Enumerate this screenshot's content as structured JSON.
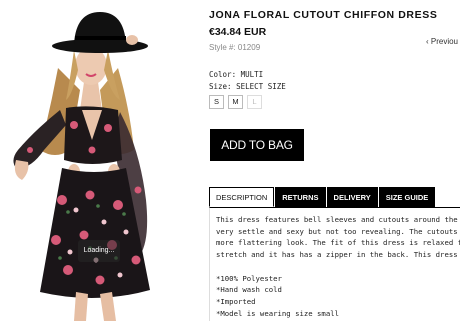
{
  "product": {
    "title": "JONA FLORAL CUTOUT CHIFFON DRESS",
    "price": "€34.84 EUR",
    "style": "Style #: 01209",
    "previous": "‹ Previou",
    "color": "Color: MULTI",
    "size_label": "Size: SELECT SIZE",
    "sizes": [
      {
        "label": "S",
        "available": true
      },
      {
        "label": "M",
        "available": true
      },
      {
        "label": "L",
        "available": false
      }
    ],
    "add_to_bag": "ADD TO BAG",
    "image_overlay": "Loading..."
  },
  "tabs": [
    "DESCRIPTION",
    "RETURNS",
    "DELIVERY",
    "SIZE GUIDE"
  ],
  "description": {
    "lines": [
      "This dress features bell sleeves and cutouts around the waist.  The",
      "very settle and sexy but not too revealing. The cutouts are around",
      "more flattering look.  The fit of this dress is relaxed for a loose fit.",
      "stretch and it has has a zipper in the back. This dress has a bohemi"
    ],
    "details": [
      "*100% Polyester",
      "*Hand wash cold",
      "*Imported",
      "*Model is wearing size small"
    ]
  },
  "colors": {
    "button_bg": "#000000",
    "dress_dark": "#1a1518",
    "floral_pink": "#d65a78",
    "hat": "#111111"
  }
}
